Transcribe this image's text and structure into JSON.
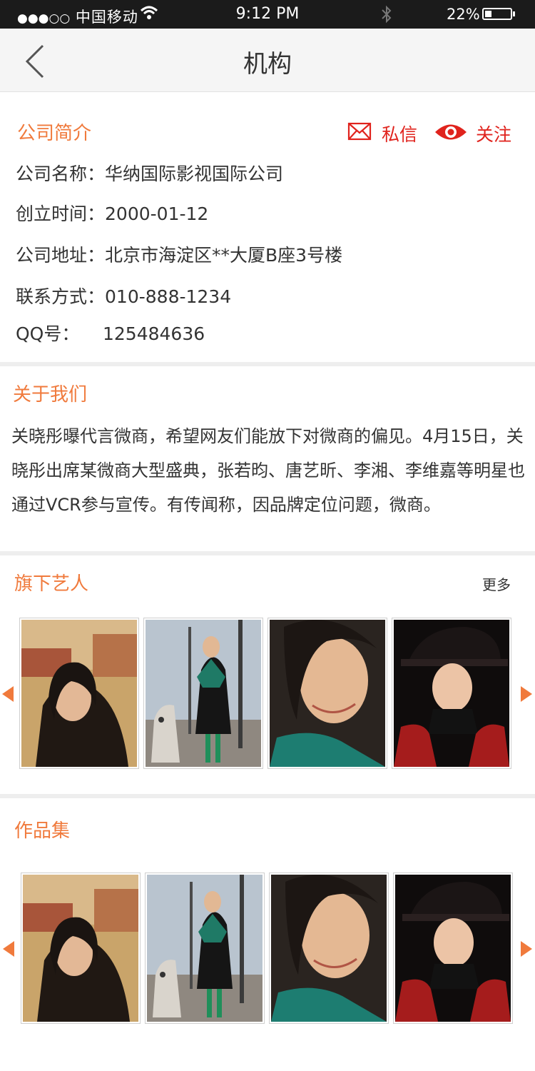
{
  "status_bar": {
    "carrier": "中国移动",
    "time": "9:12 PM",
    "battery": "22%",
    "battery_level": 0.22
  },
  "header": {
    "title": "机构"
  },
  "actions": {
    "message_label": "私信",
    "follow_label": "关注"
  },
  "company_intro": {
    "heading": "公司简介",
    "rows": [
      {
        "label": "公司名称：",
        "value": "华纳国际影视国际公司"
      },
      {
        "label": "创立时间：",
        "value": "2000-01-12"
      },
      {
        "label": "公司地址：",
        "value": "北京市海淀区**大厦B座3号楼"
      },
      {
        "label": "联系方式：",
        "value": "010-888-1234"
      },
      {
        "label": "QQ号：",
        "value": "125484636"
      }
    ]
  },
  "about": {
    "heading": "关于我们",
    "text": "关晓彤曝代言微商，希望网友们能放下对微商的偏见。4月15日，关晓彤出席某微商大型盛典，张若昀、唐艺昕、李湘、李维嘉等明星也通过VCR参与宣传。有传闻称，因品牌定位问题，微商。"
  },
  "artists": {
    "heading": "旗下艺人",
    "more_label": "更多"
  },
  "works": {
    "heading": "作品集"
  },
  "colors": {
    "accent_orange": "#f07a3c",
    "action_red": "#e0231d",
    "divider": "#eeeeee"
  }
}
